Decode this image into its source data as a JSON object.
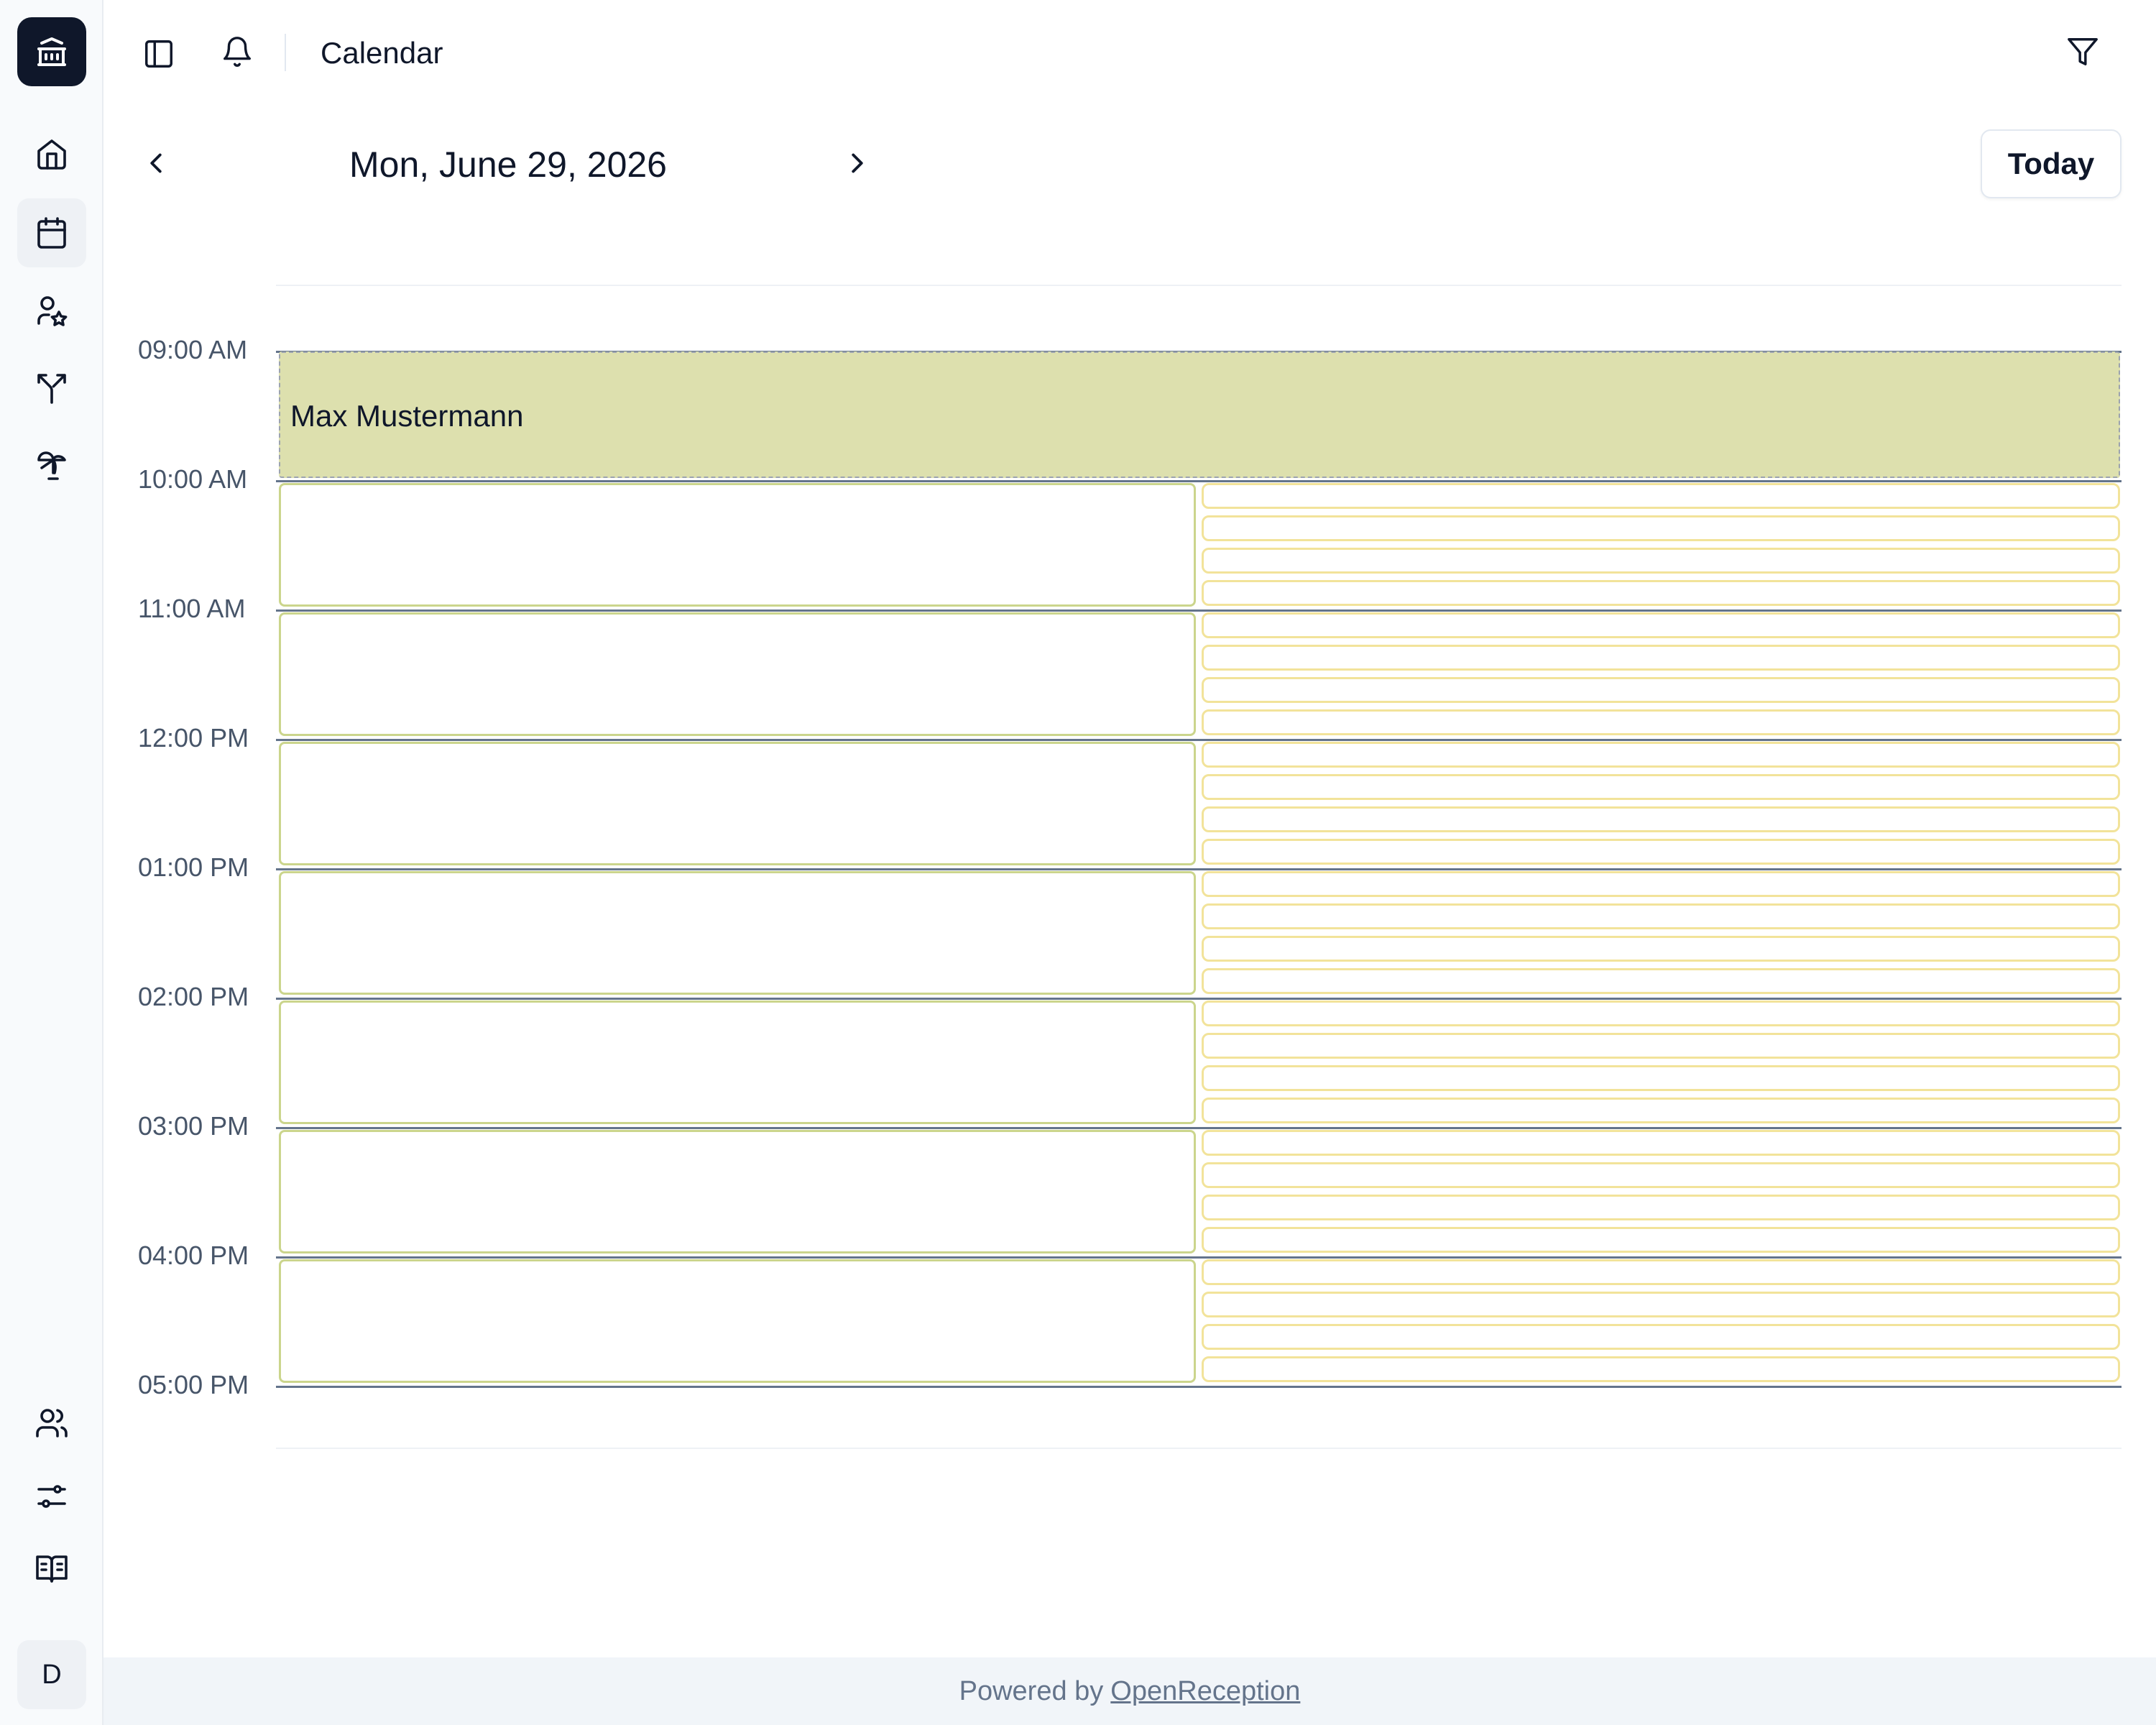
{
  "app": {
    "title": "Calendar"
  },
  "sidebar": {
    "logo_icon": "bank-icon",
    "nav": [
      {
        "name": "home",
        "icon": "home-icon"
      },
      {
        "name": "calendar",
        "icon": "calendar-icon",
        "active": true
      },
      {
        "name": "users-star",
        "icon": "user-star-icon"
      },
      {
        "name": "split",
        "icon": "split-icon"
      },
      {
        "name": "vacation",
        "icon": "palm-tree-icon"
      }
    ],
    "bottom": [
      {
        "name": "team",
        "icon": "users-icon"
      },
      {
        "name": "settings",
        "icon": "sliders-icon"
      },
      {
        "name": "docs",
        "icon": "book-icon"
      }
    ],
    "avatar": "D"
  },
  "toolbar": {
    "filter_icon": "filter-icon"
  },
  "calendar": {
    "date": "Mon, June 29, 2026",
    "today_label": "Today",
    "times": [
      "09:00 AM",
      "10:00 AM",
      "11:00 AM",
      "12:00 PM",
      "01:00 PM",
      "02:00 PM",
      "03:00 PM",
      "04:00 PM",
      "05:00 PM"
    ],
    "event": {
      "title": "Max Mustermann",
      "start": "09:00 AM",
      "end": "10:00 AM"
    }
  },
  "footer": {
    "prefix": "Powered by",
    "link": "OpenReception"
  },
  "colors": {
    "event": "#dde0ae",
    "slot_border": "#cbd58c",
    "subslot_border": "#f2e39a",
    "dark": "#0f172a"
  }
}
